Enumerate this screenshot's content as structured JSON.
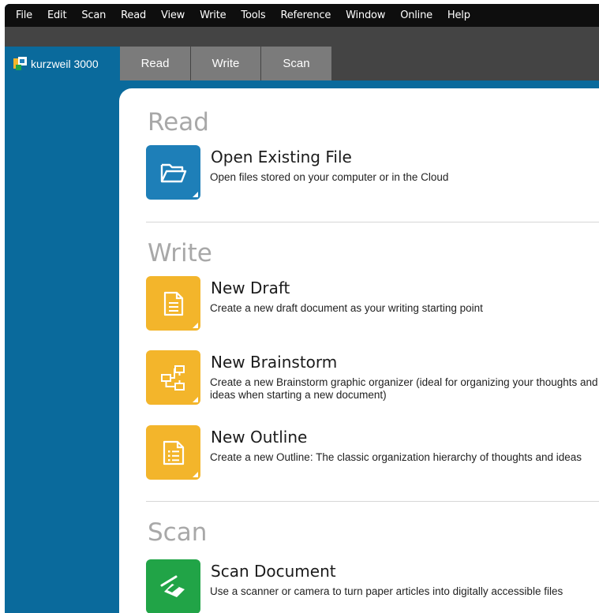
{
  "menu": [
    "File",
    "Edit",
    "Scan",
    "Read",
    "View",
    "Write",
    "Tools",
    "Reference",
    "Window",
    "Online",
    "Help"
  ],
  "logo": {
    "text": "kurzweil 3000"
  },
  "tabs": [
    "Read",
    "Write",
    "Scan"
  ],
  "sections": {
    "read": {
      "heading": "Read",
      "items": [
        {
          "title": "Open Existing File",
          "desc": "Open files stored on your computer or in the Cloud",
          "icon": "folder-icon"
        }
      ]
    },
    "write": {
      "heading": "Write",
      "items": [
        {
          "title": "New Draft",
          "desc": "Create a new draft document as your writing starting point",
          "icon": "document-icon"
        },
        {
          "title": "New Brainstorm",
          "desc": "Create a new Brainstorm graphic organizer (ideal for organizing your thoughts and ideas when starting a new document)",
          "icon": "brainstorm-icon"
        },
        {
          "title": "New Outline",
          "desc": "Create a new Outline: The classic organization hierarchy of thoughts and ideas",
          "icon": "outline-icon"
        }
      ]
    },
    "scan": {
      "heading": "Scan",
      "items": [
        {
          "title": "Scan Document",
          "desc": "Use a scanner or camera to turn paper articles into digitally accessible files",
          "icon": "scanner-icon"
        }
      ]
    }
  },
  "colors": {
    "brand_blue": "#0a6a9c",
    "read_tile": "#1e7fb8",
    "write_tile": "#f3b52b",
    "scan_tile": "#21a447",
    "tab_gray": "#7b7b7b"
  }
}
